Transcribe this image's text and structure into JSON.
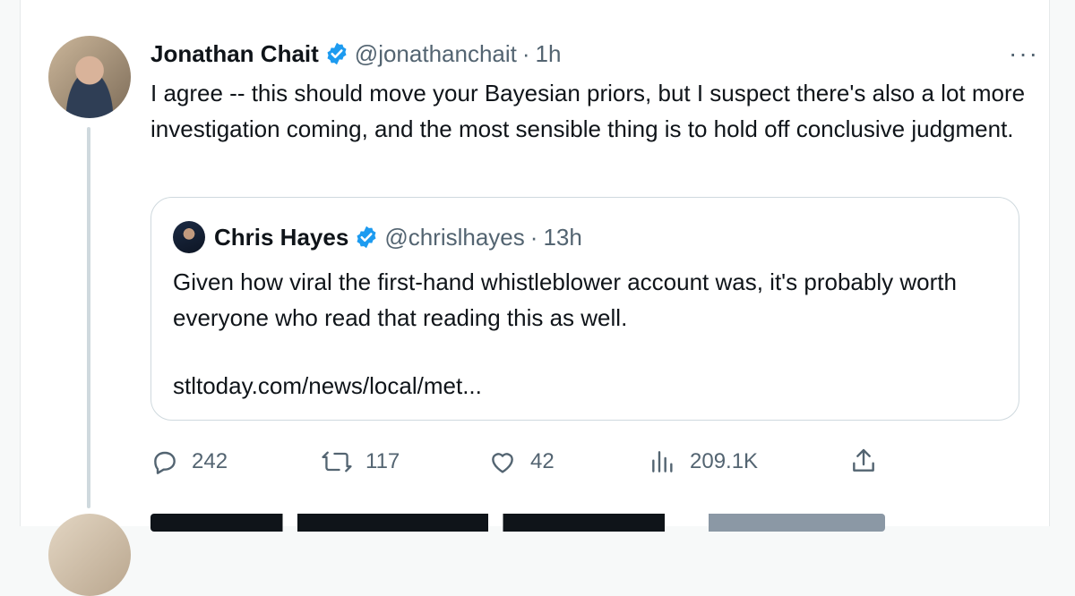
{
  "tweet": {
    "author_name": "Jonathan Chait",
    "handle": "@jonathanchait",
    "separator": "·",
    "time": "1h",
    "more_label": "···",
    "text": "I agree -- this should move your Bayesian priors, but I suspect there's also a lot more investigation coming, and the most sensible thing is to hold off conclusive judgment."
  },
  "quote": {
    "author_name": "Chris Hayes",
    "handle": "@chrislhayes",
    "separator": "·",
    "time": "13h",
    "text": "Given how viral the first-hand whistleblower account was, it's probably worth everyone who read that reading this as well.",
    "link": "stltoday.com/news/local/met..."
  },
  "actions": {
    "replies": "242",
    "retweets": "117",
    "likes": "42",
    "views": "209.1K"
  },
  "colors": {
    "verified": "#1d9bf0",
    "secondary_text": "#536471",
    "border": "#cfd9de"
  },
  "icons": [
    "verified-badge-icon",
    "more-icon",
    "reply-icon",
    "retweet-icon",
    "like-icon",
    "views-icon",
    "share-icon"
  ]
}
